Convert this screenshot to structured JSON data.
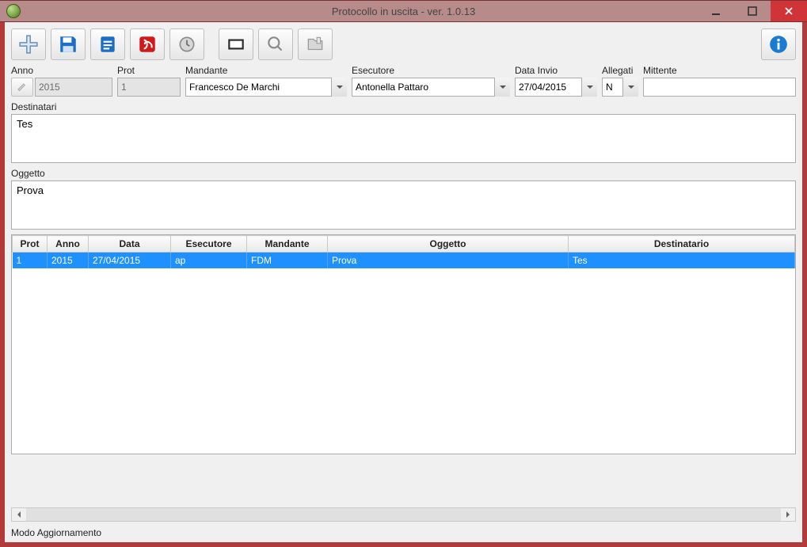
{
  "window": {
    "title": "Protocollo in uscita - ver. 1.0.13"
  },
  "toolbar": {
    "add_label": "",
    "save_label": "",
    "doc_label": "",
    "pdf_label": "",
    "log_label": "",
    "view_label": "",
    "search_label": "",
    "attach_label": "",
    "info_label": ""
  },
  "form": {
    "anno": {
      "label": "Anno",
      "value": "2015"
    },
    "prot": {
      "label": "Prot",
      "value": "1"
    },
    "mandante": {
      "label": "Mandante",
      "value": "Francesco De Marchi"
    },
    "esecutore": {
      "label": "Esecutore",
      "value": "Antonella Pattaro"
    },
    "data_invio": {
      "label": "Data Invio",
      "value": "27/04/2015"
    },
    "allegati": {
      "label": "Allegati",
      "value": "N"
    },
    "mittente": {
      "label": "Mittente",
      "value": ""
    },
    "destinatari": {
      "label": "Destinatari",
      "value": "Tes"
    },
    "oggetto": {
      "label": "Oggetto",
      "value": "Prova"
    }
  },
  "grid": {
    "headers": {
      "prot": "Prot",
      "anno": "Anno",
      "data": "Data",
      "esecutore": "Esecutore",
      "mandante": "Mandante",
      "oggetto": "Oggetto",
      "destinatario": "Destinatario"
    },
    "rows": [
      {
        "prot": "1",
        "anno": "2015",
        "data": "27/04/2015",
        "esecutore": "ap",
        "mandante": "FDM",
        "oggetto": "Prova",
        "destinatario": "Tes"
      }
    ]
  },
  "status": {
    "text": "Modo Aggiornamento"
  }
}
